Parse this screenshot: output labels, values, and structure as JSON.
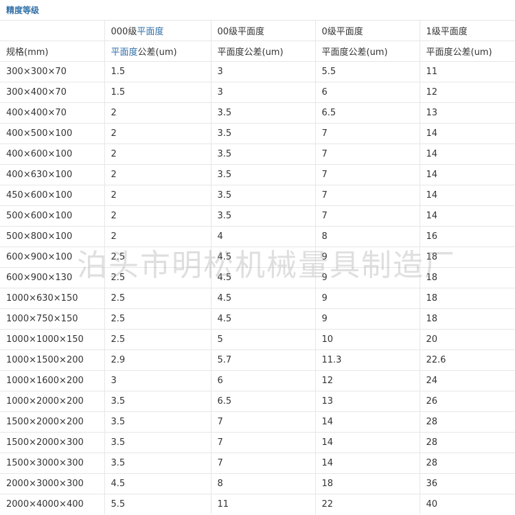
{
  "title": "精度等级",
  "header": {
    "row1": {
      "col1_prefix": "000级",
      "col1_link": "平面度",
      "col2": "00级平面度",
      "col3": "0级平面度",
      "col4": "1级平面度"
    },
    "row2": {
      "col0": "规格(mm)",
      "col1_link": "平面度",
      "col1_suffix": "公差(um)",
      "col2": "平面度公差(um)",
      "col3": "平面度公差(um)",
      "col4": "平面度公差(um)"
    }
  },
  "rows": [
    [
      "300×300×70",
      "1.5",
      "3",
      "5.5",
      "11"
    ],
    [
      "300×400×70",
      "1.5",
      "3",
      "6",
      "12"
    ],
    [
      "400×400×70",
      "2",
      "3.5",
      "6.5",
      "13"
    ],
    [
      "400×500×100",
      "2",
      "3.5",
      "7",
      "14"
    ],
    [
      "400×600×100",
      "2",
      "3.5",
      "7",
      "14"
    ],
    [
      "400×630×100",
      "2",
      "3.5",
      "7",
      "14"
    ],
    [
      "450×600×100",
      "2",
      "3.5",
      "7",
      "14"
    ],
    [
      "500×600×100",
      "2",
      "3.5",
      "7",
      "14"
    ],
    [
      "500×800×100",
      "2",
      "4",
      "8",
      "16"
    ],
    [
      "600×900×100",
      "2.5",
      "4.5",
      "9",
      "18"
    ],
    [
      "600×900×130",
      "2.5",
      "4.5",
      "9",
      "18"
    ],
    [
      "1000×630×150",
      "2.5",
      "4.5",
      "9",
      "18"
    ],
    [
      "1000×750×150",
      "2.5",
      "4.5",
      "9",
      "18"
    ],
    [
      "1000×1000×150",
      "2.5",
      "5",
      "10",
      "20"
    ],
    [
      "1000×1500×200",
      "2.9",
      "5.7",
      "11.3",
      "22.6"
    ],
    [
      "1000×1600×200",
      "3",
      "6",
      "12",
      "24"
    ],
    [
      "1000×2000×200",
      "3.5",
      "6.5",
      "13",
      "26"
    ],
    [
      "1500×2000×200",
      "3.5",
      "7",
      "14",
      "28"
    ],
    [
      "1500×2000×300",
      "3.5",
      "7",
      "14",
      "28"
    ],
    [
      "1500×3000×300",
      "3.5",
      "7",
      "14",
      "28"
    ],
    [
      "2000×3000×300",
      "4.5",
      "8",
      "18",
      "36"
    ],
    [
      "2000×4000×400",
      "5.5",
      "11",
      "22",
      "40"
    ]
  ],
  "watermark": "泊头市明松机械量具制造厂",
  "colors": {
    "link": "#2f6fa7",
    "text": "#333333",
    "grid": "#e6e6e6"
  }
}
